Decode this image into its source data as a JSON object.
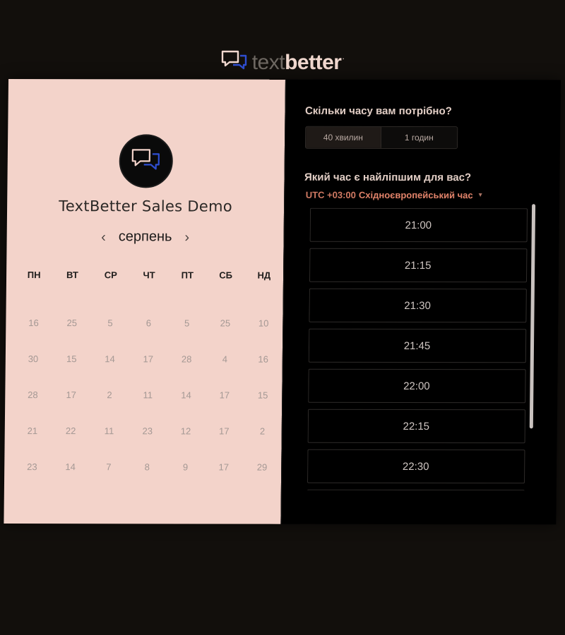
{
  "brand": {
    "text_light": "text",
    "text_bold": "better",
    "dot": ".",
    "icon": "chat-bubbles-icon"
  },
  "left_panel": {
    "avatar_icon": "chat-bubbles-icon",
    "event_title": "TextBetter Sales Demo",
    "month": "серпень",
    "prev_icon": "chevron-left-icon",
    "next_icon": "chevron-right-icon",
    "prev_label": "‹",
    "next_label": "›",
    "weekdays": [
      "ПН",
      "ВТ",
      "СР",
      "ЧТ",
      "ПТ",
      "СБ",
      "НД"
    ],
    "weeks": [
      [
        "16",
        "25",
        "5",
        "6",
        "5",
        "25",
        "10"
      ],
      [
        "30",
        "15",
        "14",
        "17",
        "28",
        "4",
        "16"
      ],
      [
        "28",
        "17",
        "2",
        "11",
        "14",
        "17",
        "15"
      ],
      [
        "21",
        "22",
        "11",
        "23",
        "12",
        "17",
        "2"
      ],
      [
        "23",
        "14",
        "7",
        "8",
        "9",
        "17",
        "29"
      ]
    ]
  },
  "right_panel": {
    "duration_question": "Скільки часу вам потрібно?",
    "duration_options": [
      "40 хвилин",
      "1 годин"
    ],
    "duration_selected": "40 хвилин",
    "time_question": "Який час є найліпшим для вас?",
    "tz_offset": "UTC +03:00",
    "tz_name": "Східноєвропейський час",
    "tz_caret_icon": "caret-down-icon",
    "tz_caret": "▾",
    "time_slots": [
      "21:00",
      "21:15",
      "21:30",
      "21:45",
      "22:00",
      "22:15",
      "22:30",
      ""
    ]
  },
  "colors": {
    "page_bg": "#120f0c",
    "left_panel_bg": "#f3d3ca",
    "right_panel_bg": "#000000",
    "accent_timezone": "#e2836a",
    "icon_blue": "#2f4ed1"
  }
}
